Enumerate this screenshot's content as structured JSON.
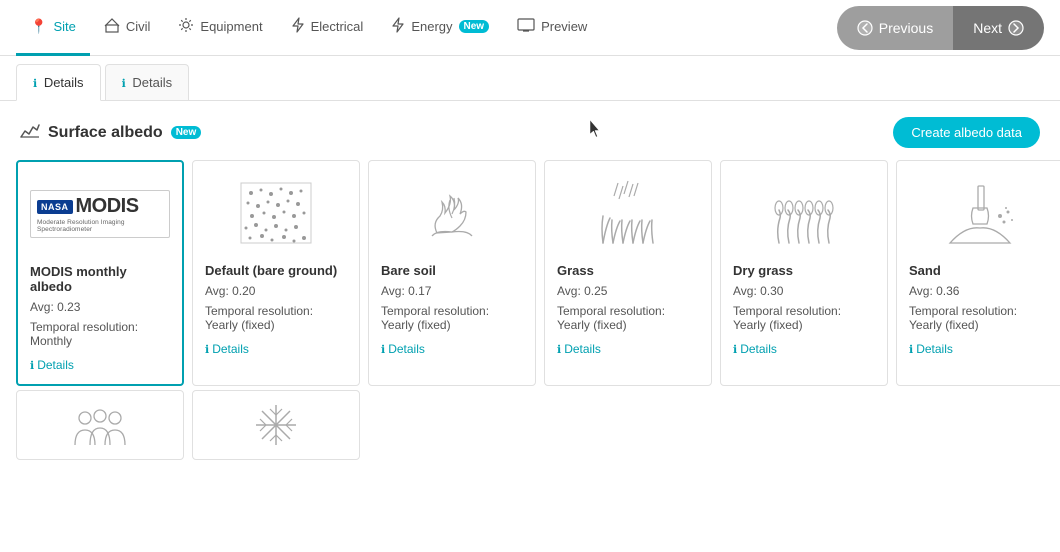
{
  "nav": {
    "tabs": [
      {
        "id": "site",
        "label": "Site",
        "icon": "📍",
        "active": true
      },
      {
        "id": "civil",
        "label": "Civil",
        "icon": "🏗",
        "active": false
      },
      {
        "id": "equipment",
        "label": "Equipment",
        "icon": "⚙",
        "active": false
      },
      {
        "id": "electrical",
        "label": "Electrical",
        "icon": "⚡",
        "active": false
      },
      {
        "id": "energy",
        "label": "Energy",
        "icon": "⚡",
        "active": false,
        "badge": "New"
      },
      {
        "id": "preview",
        "label": "Preview",
        "icon": "🖥",
        "active": false
      }
    ],
    "prev_label": "Previous",
    "next_label": "Next"
  },
  "sub_tabs": [
    {
      "id": "tab1",
      "label": "Details",
      "active": false
    },
    {
      "id": "tab2",
      "label": "Details",
      "active": false
    }
  ],
  "section": {
    "title": "Surface albedo",
    "badge": "New",
    "create_button": "Create albedo data"
  },
  "cards": [
    {
      "id": "modis",
      "name": "MODIS monthly albedo",
      "avg": "Avg: 0.23",
      "resolution": "Temporal resolution: Monthly",
      "details": "Details",
      "selected": true,
      "icon_type": "modis"
    },
    {
      "id": "default",
      "name": "Default (bare ground)",
      "avg": "Avg: 0.20",
      "resolution": "Temporal resolution: Yearly (fixed)",
      "details": "Details",
      "selected": false,
      "icon_type": "texture"
    },
    {
      "id": "bare_soil",
      "name": "Bare soil",
      "avg": "Avg: 0.17",
      "resolution": "Temporal resolution: Yearly (fixed)",
      "details": "Details",
      "selected": false,
      "icon_type": "plant"
    },
    {
      "id": "grass",
      "name": "Grass",
      "avg": "Avg: 0.25",
      "resolution": "Temporal resolution: Yearly (fixed)",
      "details": "Details",
      "selected": false,
      "icon_type": "grass"
    },
    {
      "id": "dry_grass",
      "name": "Dry grass",
      "avg": "Avg: 0.30",
      "resolution": "Temporal resolution: Yearly (fixed)",
      "details": "Details",
      "selected": false,
      "icon_type": "dry_grass"
    },
    {
      "id": "sand",
      "name": "Sand",
      "avg": "Avg: 0.36",
      "resolution": "Temporal resolution: Yearly (fixed)",
      "details": "Details",
      "selected": false,
      "icon_type": "shovel"
    }
  ]
}
